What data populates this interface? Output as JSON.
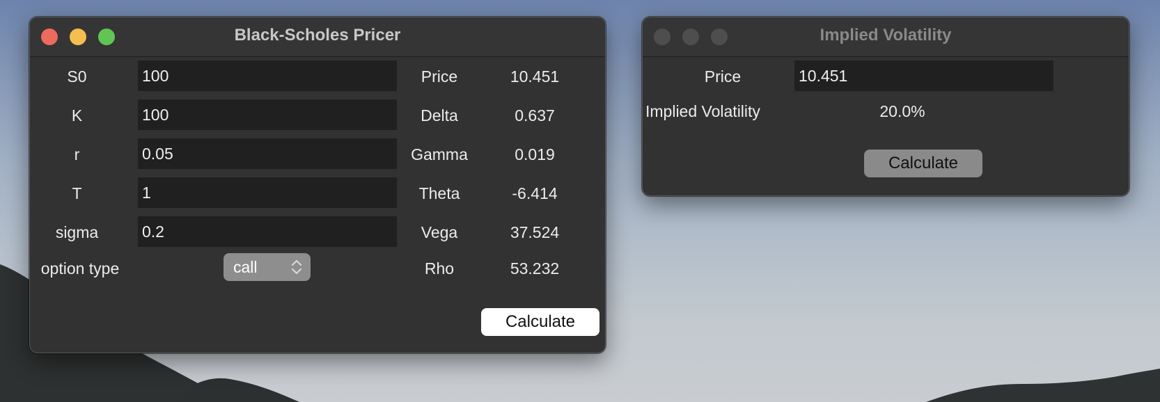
{
  "windows": {
    "pricer": {
      "title": "Black-Scholes Pricer",
      "inputs": [
        {
          "label": "S0",
          "value": "100"
        },
        {
          "label": "K",
          "value": "100"
        },
        {
          "label": "r",
          "value": "0.05"
        },
        {
          "label": "T",
          "value": "1"
        },
        {
          "label": "sigma",
          "value": "0.2"
        }
      ],
      "option_type": {
        "label": "option type",
        "value": "call"
      },
      "outputs": [
        {
          "label": "Price",
          "value": "10.451"
        },
        {
          "label": "Delta",
          "value": "0.637"
        },
        {
          "label": "Gamma",
          "value": "0.019"
        },
        {
          "label": "Theta",
          "value": "-6.414"
        },
        {
          "label": "Vega",
          "value": "37.524"
        },
        {
          "label": "Rho",
          "value": "53.232"
        }
      ],
      "calculate_label": "Calculate"
    },
    "implied_vol": {
      "title": "Implied Volatility",
      "price_label": "Price",
      "price_value": "10.451",
      "iv_label": "Implied Volatility",
      "iv_value": "20.0%",
      "calculate_label": "Calculate"
    }
  },
  "colors": {
    "close": "#ed6a5e",
    "minimize": "#f5bf4f",
    "zoom": "#61c554",
    "inactive_light": "#4e4e4e"
  },
  "icons": {
    "select_chevron": "chevron-up-down-icon"
  }
}
